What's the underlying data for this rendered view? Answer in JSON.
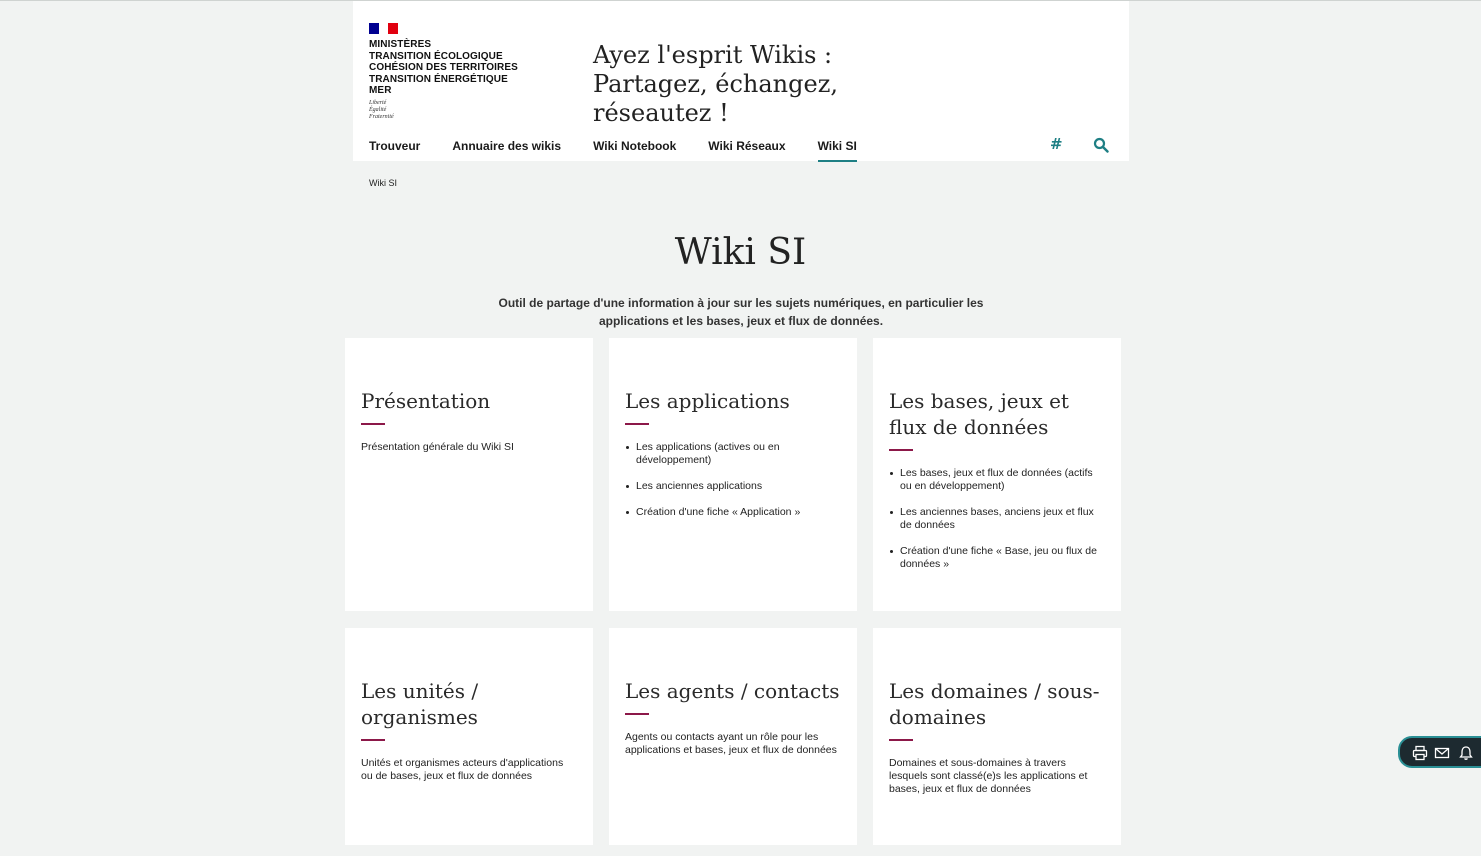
{
  "header": {
    "ministry_lines": [
      "Ministères",
      "Transition écologique",
      "Cohésion des territoires",
      "Transition énergétique",
      "Mer"
    ],
    "motto_lines": [
      "Liberté",
      "Égalité",
      "Fraternité"
    ],
    "tagline": "Ayez l'esprit Wikis : Partagez, échangez, réseautez !",
    "colors": {
      "flag_blue": "#000091",
      "flag_white": "#ffffff",
      "flag_red": "#e1000f"
    }
  },
  "nav": {
    "items": [
      {
        "label": "Trouveur"
      },
      {
        "label": "Annuaire des wikis"
      },
      {
        "label": "Wiki Notebook"
      },
      {
        "label": "Wiki Réseaux"
      },
      {
        "label": "Wiki SI",
        "active": true
      }
    ],
    "icons": [
      "hashtag-icon",
      "search-icon"
    ]
  },
  "breadcrumb": "Wiki SI",
  "page_title": "Wiki SI",
  "intro": "Outil de partage d'une information à jour sur les sujets numériques, en particulier les applications et les bases, jeux et flux de données.",
  "cards": [
    {
      "title": "Présentation",
      "desc": "Présentation générale du Wiki SI"
    },
    {
      "title": "Les applications",
      "items": [
        "Les applications (actives ou en développement)",
        "Les anciennes applications",
        "Création d'une fiche « Application »"
      ]
    },
    {
      "title": "Les bases, jeux et flux de données",
      "items": [
        "Les bases, jeux et flux de données (actifs ou en développement)",
        "Les anciennes bases, anciens jeux et flux de données",
        "Création d'une fiche « Base, jeu ou flux de données »"
      ]
    },
    {
      "title": "Les unités / organismes",
      "desc": "Unités et organismes acteurs d'applications ou de bases, jeux et flux de données"
    },
    {
      "title": "Les agents / contacts",
      "desc": "Agents ou contacts ayant un rôle pour les applications et bases, jeux et flux de données"
    },
    {
      "title": "Les domaines / sous-domaines",
      "desc": "Domaines et sous-domaines à travers lesquels sont classé(e)s les applications et bases, jeux et flux de données"
    }
  ],
  "float_bar": {
    "icons": [
      "print-icon",
      "mail-icon",
      "bell-icon"
    ]
  },
  "colors": {
    "accent_teal": "#1e7f84",
    "accent_burgundy": "#8c1849",
    "background": "#f1f3f2"
  }
}
